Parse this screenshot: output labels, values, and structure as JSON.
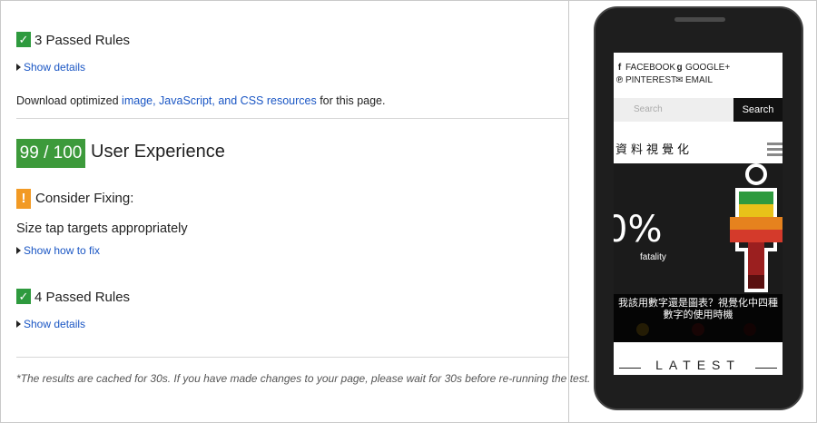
{
  "report": {
    "passed_rules_1": "3 Passed Rules",
    "show_details_1": "Show details",
    "download_prefix": "Download optimized ",
    "download_link": "image, JavaScript, and CSS resources",
    "download_suffix": " for this page.",
    "score": "99 / 100",
    "section_title": "User Experience",
    "consider_fixing": "Consider Fixing:",
    "tap_targets": "Size tap targets appropriately",
    "show_how_to_fix": "Show how to fix",
    "passed_rules_2": "4 Passed Rules",
    "show_details_2": "Show details",
    "footer": "*The results are cached for 30s. If you have made changes to your page, please wait for 30s before re-running the test."
  },
  "icons": {
    "check": "checkmark-icon",
    "warning": "exclamation-icon",
    "expand": "triangle-right-icon"
  },
  "phone": {
    "social": {
      "facebook": "FACEBOOK",
      "google": "GOOGLE+",
      "pinterest": "PINTEREST",
      "email": "EMAIL"
    },
    "search_placeholder": "Search",
    "search_button": "Search",
    "site_title": "資料視覺化",
    "hero_percent": "0%",
    "hero_fatality": "fatality",
    "hero_caption": "我該用數字還是圖表？視覺化中四種數字的使用時機",
    "latest": "LATEST"
  },
  "colors": {
    "score_bg": "#3d9a3b",
    "check_bg": "#2e9a3e",
    "warning_bg": "#f29a24",
    "link": "#1a56c4"
  }
}
